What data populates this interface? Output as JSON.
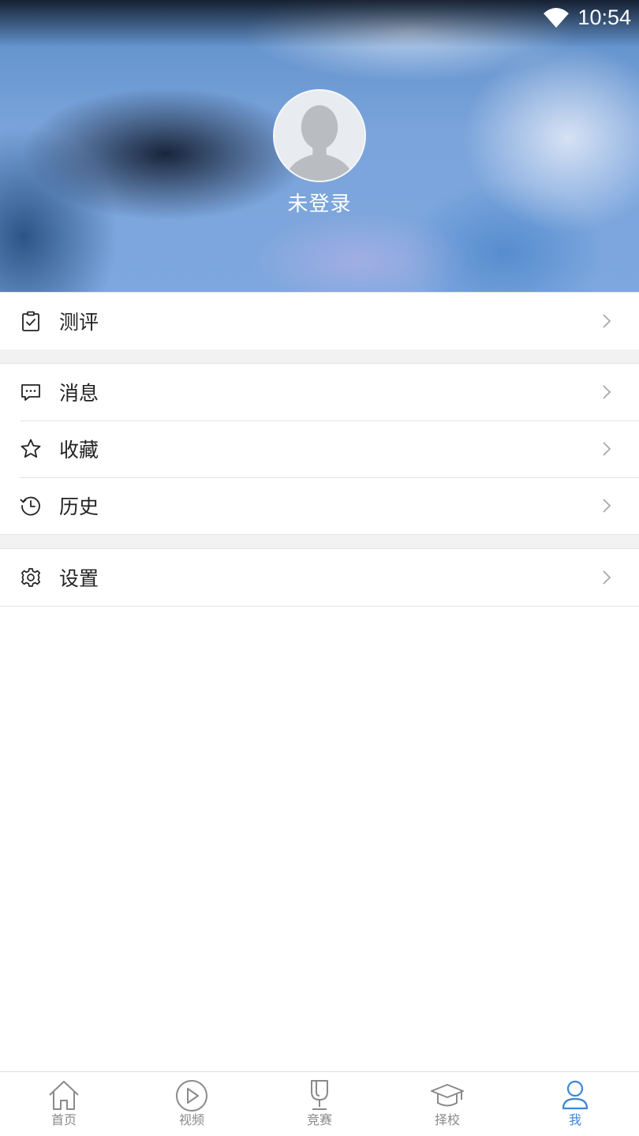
{
  "status_bar": {
    "time": "10:54",
    "wifi_icon": "wifi-icon"
  },
  "profile": {
    "avatar_icon": "default-avatar-icon",
    "name": "未登录"
  },
  "menu": {
    "evaluation": {
      "label": "测评",
      "icon": "clipboard-check-icon"
    },
    "messages": {
      "label": "消息",
      "icon": "chat-bubble-icon"
    },
    "favorites": {
      "label": "收藏",
      "icon": "star-icon"
    },
    "history": {
      "label": "历史",
      "icon": "clock-history-icon"
    },
    "settings": {
      "label": "设置",
      "icon": "gear-icon"
    }
  },
  "bottom_nav": {
    "home": {
      "label": "首页",
      "icon": "home-icon"
    },
    "video": {
      "label": "视频",
      "icon": "play-circle-icon"
    },
    "contest": {
      "label": "竞赛",
      "icon": "trophy-icon"
    },
    "school": {
      "label": "择校",
      "icon": "graduation-cap-icon"
    },
    "me": {
      "label": "我",
      "icon": "user-icon",
      "active": true
    }
  },
  "colors": {
    "accent": "#3b86d6",
    "inactive": "#8a8a8a",
    "divider_gap": "#f2f2f2"
  }
}
